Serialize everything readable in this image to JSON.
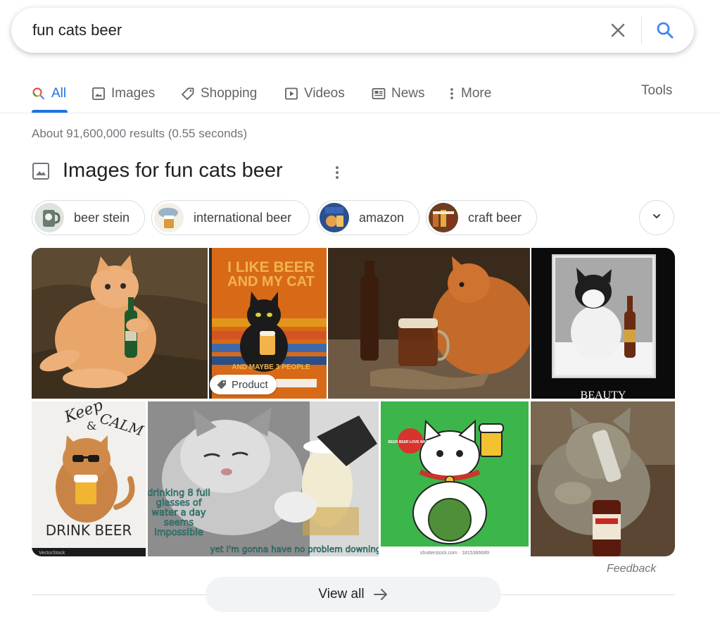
{
  "search": {
    "query": "fun cats beer"
  },
  "tabs": [
    {
      "label": "All",
      "active": true,
      "icon": "search-icon"
    },
    {
      "label": "Images",
      "icon": "image-icon"
    },
    {
      "label": "Shopping",
      "icon": "tag-icon"
    },
    {
      "label": "Videos",
      "icon": "play-icon"
    },
    {
      "label": "News",
      "icon": "news-icon"
    },
    {
      "label": "More",
      "icon": "more-vert-icon"
    }
  ],
  "tools_label": "Tools",
  "result_stats": "About 91,600,000 results (0.55 seconds)",
  "images_section": {
    "title": "Images for fun cats beer",
    "chips": [
      {
        "label": "beer stein"
      },
      {
        "label": "international beer"
      },
      {
        "label": "amazon"
      },
      {
        "label": "craft beer"
      }
    ],
    "poster_1": {
      "line1": "I LIKE BEER",
      "line2": "AND MY CAT",
      "line3": "AND MAYBE 3 PEOPLE"
    },
    "poster_2": {
      "caption": "BEAUTY"
    },
    "poster_3": {
      "top": "Keep",
      "amp": "&",
      "calm": "CALM",
      "bottom": "DRINK BEER",
      "watermark": "VectorStock"
    },
    "meme": {
      "lines": [
        "drinking 8 full",
        "glasses of",
        "water a day",
        "seems",
        "impossible"
      ],
      "bottom": "yet I'm gonna have no problem downing"
    },
    "shutterstock": {
      "watermark": "shutterstock.com · 1815386689",
      "bubble": "BEER BEER LOVE WATER"
    },
    "product_badge": "Product",
    "feedback": "Feedback",
    "view_all": "View all"
  },
  "colors": {
    "accent": "#1a73e8",
    "muted": "#70757a",
    "chip_border": "#dadce0",
    "view_all_bg": "#f1f3f4"
  }
}
